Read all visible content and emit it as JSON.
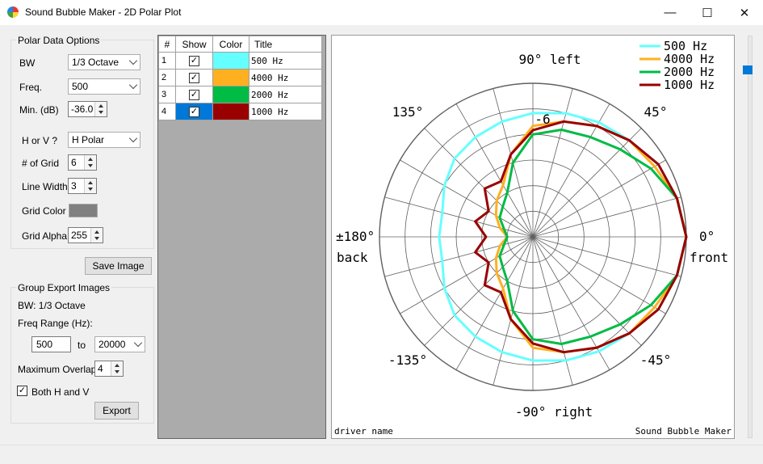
{
  "window": {
    "title": "Sound Bubble Maker - 2D Polar Plot",
    "buttons": [
      "—",
      "☐",
      "✕"
    ]
  },
  "options": {
    "group_title": "Polar Data Options",
    "bw_label": "BW",
    "bw_value": "1/3 Octave",
    "freq_label": "Freq.",
    "freq_value": "500",
    "min_label": "Min. (dB)",
    "min_value": "-36.0",
    "hv_label": "H or V ?",
    "hv_value": "H Polar",
    "grid_count_label": "# of Grid",
    "grid_count_value": "6",
    "line_width_label": "Line Width",
    "line_width_value": "3",
    "grid_color_label": "Grid Color",
    "grid_color_value": "#808080",
    "grid_alpha_label": "Grid Alpha",
    "grid_alpha_value": "255",
    "save_button": "Save Image"
  },
  "export": {
    "group_title": "Group Export Images",
    "bw_text": "BW: 1/3 Octave",
    "range_label": "Freq Range (Hz):",
    "range_from": "500",
    "range_to_label": "to",
    "range_to": "20000",
    "overlap_label": "Maximum Overlap",
    "overlap_value": "4",
    "both_label": "Both H and V",
    "both_checked": true,
    "export_button": "Export"
  },
  "table": {
    "headers": [
      "#",
      "Show",
      "Color",
      "Title"
    ],
    "rows": [
      {
        "num": "1",
        "show": true,
        "color": "#66ffff",
        "title": "500 Hz"
      },
      {
        "num": "2",
        "show": true,
        "color": "#ffb020",
        "title": "4000 Hz"
      },
      {
        "num": "3",
        "show": true,
        "color": "#00bb44",
        "title": "2000 Hz"
      },
      {
        "num": "4",
        "show": true,
        "color": "#990000",
        "title": "1000 Hz"
      }
    ]
  },
  "plot": {
    "label_90": "90° left",
    "label_m90": "-90° right",
    "label_180a": "±180°",
    "label_180b": "back",
    "label_0a": "0°",
    "label_0b": "front",
    "label_135": "135°",
    "label_45": "45°",
    "label_m135": "-135°",
    "label_m45": "-45°",
    "ring_label": "-6",
    "footer_left": "driver name",
    "footer_right": "Sound Bubble Maker"
  },
  "chart_data": {
    "type": "polar",
    "r_min_db": -36,
    "r_max_db": 0,
    "grid_step_db": 6,
    "angle_step_deg": 15,
    "angles_deg": [
      0,
      15,
      30,
      45,
      60,
      75,
      90,
      105,
      120,
      135,
      150,
      165,
      180,
      -165,
      -150,
      -135,
      -120,
      -105,
      -90,
      -75,
      -60,
      -45,
      -30,
      -15
    ],
    "series": [
      {
        "name": "500 Hz",
        "color": "#66ffff",
        "values": [
          0,
          -1,
          -2,
          -4,
          -5,
          -6,
          -7,
          -8,
          -9,
          -10,
          -12,
          -14,
          -14,
          -14,
          -12,
          -10,
          -9,
          -8,
          -7,
          -6,
          -5,
          -4,
          -2,
          -1
        ]
      },
      {
        "name": "4000 Hz",
        "color": "#ffb020",
        "values": [
          0,
          -1,
          -3,
          -4,
          -6,
          -8,
          -10,
          -16,
          -22,
          -24,
          -26,
          -28,
          -30,
          -28,
          -26,
          -24,
          -22,
          -16,
          -10,
          -8,
          -6,
          -4,
          -3,
          -1
        ]
      },
      {
        "name": "2000 Hz",
        "color": "#00bb44",
        "values": [
          0,
          -1,
          -4,
          -7,
          -9,
          -10,
          -12,
          -18,
          -24,
          -26,
          -27,
          -29,
          -30,
          -29,
          -27,
          -26,
          -24,
          -18,
          -12,
          -10,
          -9,
          -7,
          -4,
          -1
        ]
      },
      {
        "name": "1000 Hz",
        "color": "#990000",
        "values": [
          0,
          -1,
          -2,
          -4,
          -6,
          -8,
          -11,
          -16,
          -21,
          -20,
          -24,
          -22,
          -25,
          -22,
          -24,
          -20,
          -21,
          -16,
          -11,
          -8,
          -6,
          -4,
          -2,
          -1
        ]
      }
    ]
  }
}
